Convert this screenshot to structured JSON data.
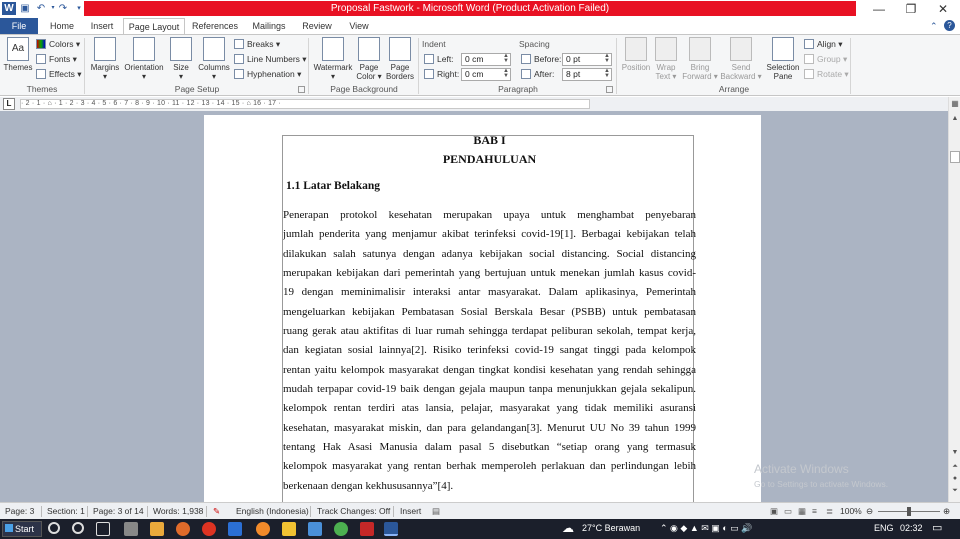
{
  "window": {
    "title": "Proposal Fastwork  -  Microsoft Word (Product Activation Failed)"
  },
  "tabs": [
    "File",
    "Home",
    "Insert",
    "Page Layout",
    "References",
    "Mailings",
    "Review",
    "View"
  ],
  "ribbon": {
    "themes": {
      "themes_label": "Themes",
      "colors_label": "Colors",
      "fonts_label": "Fonts",
      "effects_label": "Effects",
      "group_label": "Themes"
    },
    "page_setup": {
      "margins_label": "Margins",
      "orientation_label": "Orientation",
      "size_label": "Size",
      "columns_label": "Columns",
      "breaks_label": "Breaks",
      "line_numbers_label": "Line Numbers",
      "hyphenation_label": "Hyphenation",
      "group_label": "Page Setup"
    },
    "page_background": {
      "watermark_label": "Watermark",
      "page_color_label1": "Page",
      "page_color_label2": "Color",
      "page_borders_label1": "Page",
      "page_borders_label2": "Borders",
      "group_label": "Page Background"
    },
    "paragraph": {
      "indent_label": "Indent",
      "left_label": "Left:",
      "left_value": "0 cm",
      "right_label": "Right:",
      "right_value": "0 cm",
      "spacing_label": "Spacing",
      "before_label": "Before:",
      "before_value": "0 pt",
      "after_label": "After:",
      "after_value": "8 pt",
      "group_label": "Paragraph"
    },
    "arrange": {
      "position_label": "Position",
      "wrap_label1": "Wrap",
      "wrap_label2": "Text",
      "bring_label1": "Bring",
      "bring_label2": "Forward",
      "send_label1": "Send",
      "send_label2": "Backward",
      "selection_label1": "Selection",
      "selection_label2": "Pane",
      "align_label": "Align",
      "group_btn_label": "Group",
      "rotate_label": "Rotate",
      "group_label": "Arrange"
    }
  },
  "ruler_text": "· 2 · 1 · ⌂ · 1 · 2 · 3 · 4 · 5 · 6 · 7 · 8 · 9 · 10 · 11 · 12 · 13 · 14 · 15 · ⌂ 16 · 17 ·",
  "document": {
    "heading1": "BAB I",
    "heading2": "PENDAHULUAN",
    "section": "1.1 Latar Belakang",
    "lines": [
      "        Penerapan  protokol  kesehatan  merupakan  upaya  untuk  menghambat  penyebaran",
      "jumlah  penderita  yang  menjamur  akibat  terinfeksi  covid-19[1].  Berbagai  kebijakan  telah",
      "dilakukan  salah  satunya  dengan  adanya  kebijakan  social  distancing.  Social  distancing",
      "merupakan  kebijakan  dari  pemerintah  yang  bertujuan  untuk  menekan  jumlah  kasus  covid-",
      "19  dengan    meminimalisir  interaksi  antar  masyarakat.  Dalam  aplikasinya,  Pemerintah",
      "mengeluarkan  kebijakan  Pembatasan  Sosial  Berskala  Besar  (PSBB)  untuk  pembatasan",
      "ruang  gerak  atau  aktifitas  di  luar  rumah  sehingga  terdapat  peliburan  sekolah,  tempat  kerja,",
      "dan  kegiatan  sosial  lainnya[2].  Risiko  terinfeksi  covid-19  sangat  tinggi  pada  kelompok",
      "rentan  yaitu  kelompok  masyarakat  dengan  tingkat  kondisi  kesehatan  yang  rendah  sehingga",
      "mudah  terpapar  covid-19  baik  dengan  gejala  maupun  tanpa  menunjukkan  gejala  sekalipun.",
      "kelompok  rentan  terdiri  atas  lansia,  pelajar,  masyarakat  yang  tidak  memiliki  asuransi",
      "kesehatan,  masyarakat  miskin,  dan  para  gelandangan[3].  Menurut  UU  No  39  tahun  1999",
      "tentang  Hak  Asasi  Manusia  dalam  pasal  5  disebutkan  “setiap  orang  yang  termasuk",
      "kelompok  masyarakat  yang  rentan  berhak  memperoleh  perlakuan  dan  perlindungan  lebih",
      "berkenaan  dengan  kekhususannya”[4]."
    ]
  },
  "status": {
    "page": "Page: 3",
    "section": "Section: 1",
    "page_of": "Page: 3 of 14",
    "words": "Words: 1,938",
    "language": "English (Indonesia)",
    "track": "Track Changes: Off",
    "mode": "Insert",
    "zoom": "100%"
  },
  "watermark": {
    "line1": "Activate Windows",
    "line2": "Go to Settings to activate Windows."
  },
  "taskbar": {
    "start_label": "Start",
    "weather": "27°C  Berawan",
    "lang": "ENG",
    "time": "02:32"
  }
}
